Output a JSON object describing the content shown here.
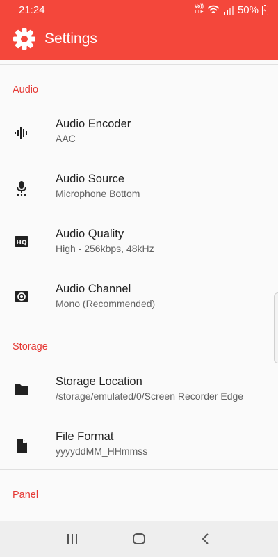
{
  "status_bar": {
    "time": "21:24",
    "network": "VoLTE",
    "battery": "50%"
  },
  "toolbar": {
    "title": "Settings",
    "icon": "gear-icon"
  },
  "sections": {
    "audio": {
      "header": "Audio",
      "items": [
        {
          "title": "Audio Encoder",
          "summary": "AAC",
          "icon": "waveform-icon"
        },
        {
          "title": "Audio Source",
          "summary": "Microphone Bottom",
          "icon": "microphone-icon"
        },
        {
          "title": "Audio Quality",
          "summary": "High - 256kbps, 48kHz",
          "icon": "hq-icon"
        },
        {
          "title": "Audio Channel",
          "summary": "Mono (Recommended)",
          "icon": "speaker-icon"
        }
      ]
    },
    "storage": {
      "header": "Storage",
      "items": [
        {
          "title": "Storage Location",
          "summary": "/storage/emulated/0/Screen Recorder Edge",
          "icon": "folder-icon"
        },
        {
          "title": "File Format",
          "summary": "yyyyddMM_HHmmss",
          "icon": "file-icon"
        }
      ]
    },
    "panel": {
      "header": "Panel"
    }
  },
  "colors": {
    "accent": "#f4473b",
    "section_header": "#e53935",
    "background": "#fafafa"
  }
}
